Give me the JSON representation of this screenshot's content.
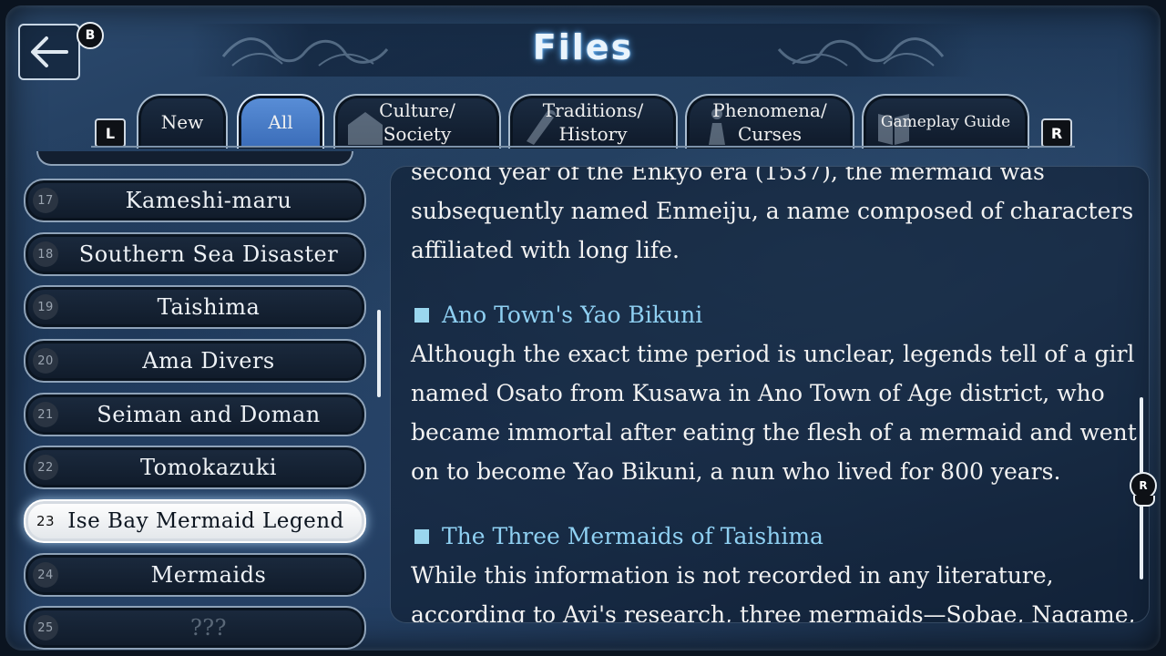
{
  "header": {
    "title": "Files",
    "back_button_glyph": "B"
  },
  "tabs": {
    "left_shoulder": "L",
    "right_shoulder": "R",
    "items": [
      {
        "label": "New",
        "active": false
      },
      {
        "label": "All",
        "active": true
      },
      {
        "label": "Culture/\nSociety",
        "active": false,
        "icon": "building-icon"
      },
      {
        "label": "Traditions/\nHistory",
        "active": false,
        "icon": "scroll-icon"
      },
      {
        "label": "Phenomena/\nCurses",
        "active": false,
        "icon": "figure-icon"
      },
      {
        "label": "Gameplay Guide",
        "active": false,
        "icon": "book-icon"
      }
    ]
  },
  "file_list": {
    "items": [
      {
        "num": "17",
        "label": "Kameshi-maru"
      },
      {
        "num": "18",
        "label": "Southern Sea Disaster"
      },
      {
        "num": "19",
        "label": "Taishima"
      },
      {
        "num": "20",
        "label": "Ama Divers"
      },
      {
        "num": "21",
        "label": "Seiman and Doman"
      },
      {
        "num": "22",
        "label": "Tomokazuki"
      },
      {
        "num": "23",
        "label": "Ise Bay Mermaid Legend",
        "selected": true
      },
      {
        "num": "24",
        "label": "Mermaids"
      },
      {
        "num": "25",
        "label": "???",
        "locked": true
      }
    ]
  },
  "content": {
    "para1_partial": "second year of the Enkyō era (1537), the mermaid was",
    "para1_line2": "subsequently named Enmeiju, a name composed of characters",
    "para1_line3": "affiliated with long life.",
    "heading1": "Ano Town's Yao Bikuni",
    "para2": [
      "Although the exact time period is unclear, legends tell of a girl",
      "named Osato from Kusawa in Ano Town of Age district, who",
      "became immortal after eating the flesh of a mermaid and went",
      "on to become Yao Bikuni, a nun who lived for 800 years."
    ],
    "heading2": "The Three Mermaids of Taishima",
    "para3": [
      "While this information is not recorded in any literature,",
      "according to Avi's research, three mermaids—Sobae, Nagame,"
    ]
  },
  "controls": {
    "scroll_stick_glyph": "R"
  }
}
